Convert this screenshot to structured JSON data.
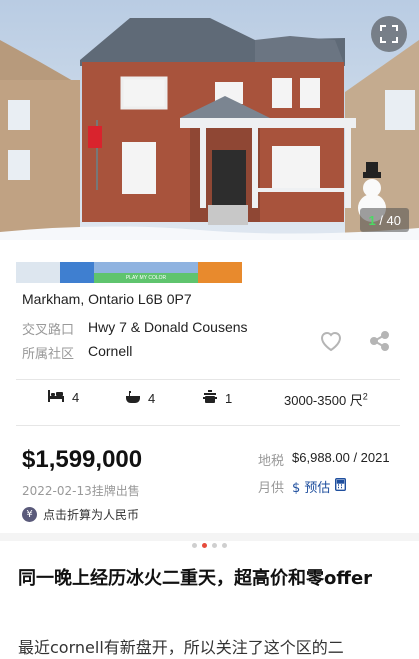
{
  "gallery": {
    "current": "1",
    "total": "/ 40",
    "expand_icon": "expand-icon"
  },
  "brand_strip": {
    "label": "PLAY MY COLOR",
    "colors": [
      "#dde6ef",
      "#3f7fd0",
      "#5fc46e",
      "#e88a2d"
    ]
  },
  "listing": {
    "address": "Markham, Ontario L6B 0P7",
    "intersection_label": "交叉路口",
    "intersection": "Hwy 7 & Donald Cousens",
    "community_label": "所属社区",
    "community": "Cornell",
    "favorite_icon": "heart-icon",
    "share_icon": "share-icon"
  },
  "specs": {
    "bedrooms": "4",
    "bathrooms": "4",
    "kitchens": "1",
    "area": "3000-3500 尺",
    "area_sup": "2"
  },
  "price": {
    "amount": "$1,599,000",
    "listed": "2022-02-13挂牌出售",
    "rmb_label": "点击折算为人民币",
    "rmb_icon": "¥",
    "tax_label": "地税",
    "tax_value": "$6,988.00 / 2021",
    "monthly_label": "月供",
    "monthly_value": "$ 预估",
    "calculator_icon": "calculator-icon"
  },
  "carousel": {
    "dot_count": 4,
    "active_index": 1
  },
  "article": {
    "title": "同一晚上经历冰火二重天，超高价和零offer",
    "body": "最近cornell有新盘开，所以关注了这个区的二"
  },
  "colors": {
    "accent_blue": "#1f4f9e",
    "active_dot": "#e64b3c",
    "counter_green": "#4cd964"
  }
}
